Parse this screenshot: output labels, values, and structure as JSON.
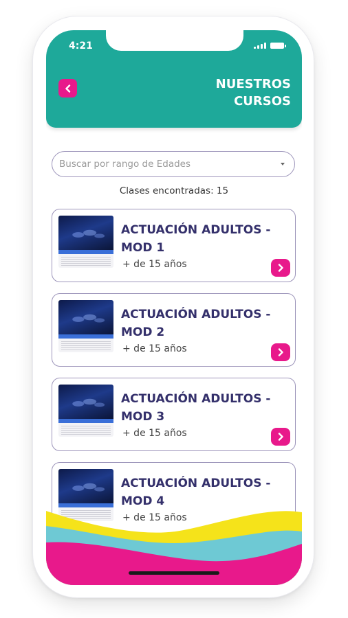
{
  "status_bar": {
    "time": "4:21"
  },
  "header": {
    "title_line1": "NUESTROS",
    "title_line2": "CURSOS",
    "back_icon": "chevron-left-icon"
  },
  "search": {
    "placeholder": "Buscar por rango de Edades",
    "dropdown_icon": "caret-down-icon"
  },
  "results": {
    "found_text": "Clases encontradas: 15"
  },
  "courses": [
    {
      "title": "ACTUACIÓN ADULTOS - MOD 1",
      "age": "+ de 15 años"
    },
    {
      "title": "ACTUACIÓN ADULTOS - MOD 2",
      "age": "+ de 15 años"
    },
    {
      "title": "ACTUACIÓN ADULTOS - MOD 3",
      "age": "+ de 15 años"
    },
    {
      "title": "ACTUACIÓN ADULTOS - MOD 4",
      "age": "+ de 15 años"
    }
  ],
  "colors": {
    "header_teal": "#1ea99a",
    "accent_pink": "#e8198b",
    "title_navy": "#34306b",
    "border_lavender": "#9c94ba",
    "wave_yellow": "#f5e31a",
    "wave_cyan": "#6ec9d4"
  }
}
